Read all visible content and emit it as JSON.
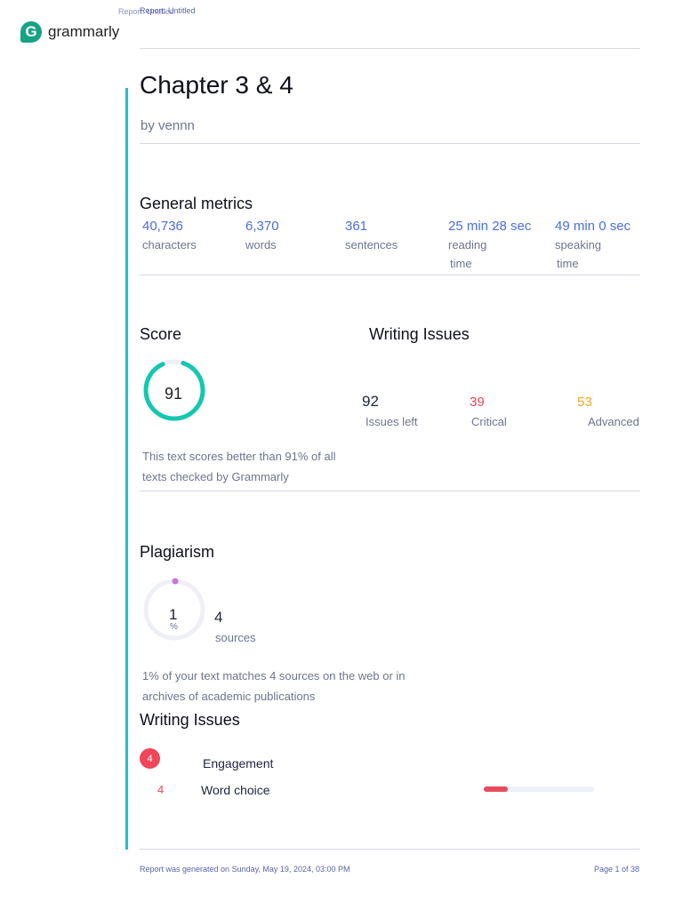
{
  "header": {
    "report_title": "Report: Untitled",
    "logo_text": "grammarly"
  },
  "doc": {
    "title": "Chapter 3 & 4",
    "author": "by vennn"
  },
  "general_metrics": {
    "heading": "General metrics",
    "items": [
      {
        "value": "40,736",
        "label": "characters"
      },
      {
        "value": "6,370",
        "label": "words"
      },
      {
        "value": "361",
        "label": "sentences"
      },
      {
        "value": "25 min 28 sec",
        "label": "reading",
        "label2": "time"
      },
      {
        "value": "49 min 0 sec",
        "label": "speaking",
        "label2": "time"
      }
    ]
  },
  "score": {
    "heading": "Score",
    "value": "91",
    "percent": 91,
    "description1": "This text scores better than 91% of all",
    "description2": "texts checked by Grammarly"
  },
  "writing_issues_summary": {
    "heading": "Writing Issues",
    "left": "92",
    "left_label": "Issues left",
    "critical": "39",
    "critical_label": "Critical",
    "advanced": "53",
    "advanced_label": "Advanced"
  },
  "plagiarism": {
    "heading": "Plagiarism",
    "percent": "1",
    "percent_sign": "%",
    "sources": "4",
    "sources_label": "sources",
    "description1": "1% of your text matches 4 sources on the web or in",
    "description2": "archives of academic publications"
  },
  "writing_issues": {
    "heading": "Writing Issues",
    "category_count": "4",
    "category": "Engagement",
    "items": [
      {
        "count": "4",
        "label": "Word choice",
        "fraction": 0.22
      }
    ]
  },
  "footer": {
    "generated": "Report was generated on Sunday, May 19, 2024, 03:00 PM",
    "page": "Page 1 of 38"
  },
  "colors": {
    "accent": "#15c39a",
    "sidebar": "#1fc1c9",
    "critical": "#f0455a",
    "advanced": "#f5a623",
    "link": "#4a6ee0"
  }
}
